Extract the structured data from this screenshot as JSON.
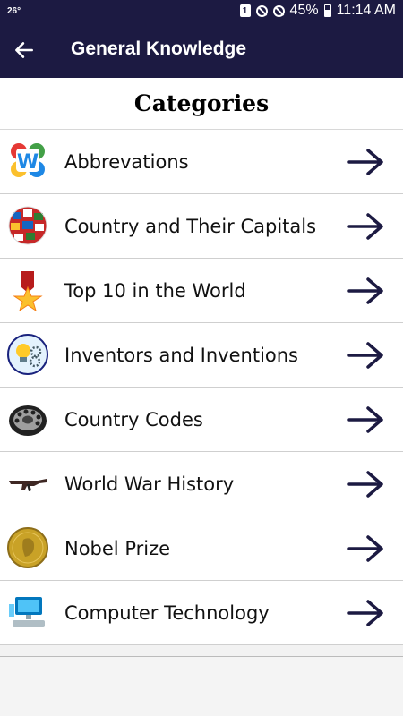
{
  "status": {
    "temp": "26°",
    "sim": "1",
    "battery": "45%",
    "time": "11:14 AM"
  },
  "app_bar": {
    "title": "General Knowledge"
  },
  "header": {
    "title": "Categories"
  },
  "categories": [
    {
      "label": "Abbrevations",
      "icon": "abbreviation-w-icon"
    },
    {
      "label": "Country and Their Capitals",
      "icon": "globe-flags-icon"
    },
    {
      "label": "Top 10 in the World",
      "icon": "medal-icon"
    },
    {
      "label": "Inventors and Inventions",
      "icon": "lightbulb-gears-icon"
    },
    {
      "label": "Country Codes",
      "icon": "rotary-dial-icon"
    },
    {
      "label": "World War History",
      "icon": "rifle-icon"
    },
    {
      "label": "Nobel Prize",
      "icon": "nobel-medal-icon"
    },
    {
      "label": "Computer Technology",
      "icon": "computer-icon"
    }
  ],
  "colors": {
    "app_bar": "#1c1a42",
    "arrow": "#1c1a42"
  }
}
